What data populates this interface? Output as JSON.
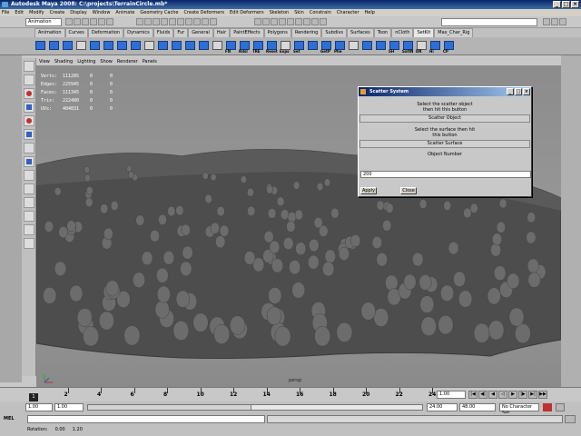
{
  "window": {
    "title": "Autodesk Maya 2008: C:\\projects\\TerrainCircle.mb*",
    "controls": [
      "_",
      "□",
      "×"
    ]
  },
  "menubar": [
    "File",
    "Edit",
    "Modify",
    "Create",
    "Display",
    "Window",
    "Animate",
    "Geometry Cache",
    "Create Deformers",
    "Edit Deformers",
    "Skeleton",
    "Skin",
    "Constrain",
    "Character",
    "Help"
  ],
  "status_line": {
    "mode": "Animation"
  },
  "shelf": {
    "tabs": [
      "Animation",
      "Curves",
      "Deformation",
      "Dynamics",
      "Fluids",
      "Fur",
      "General",
      "Hair",
      "PaintEffects",
      "Polygons",
      "Rendering",
      "Subdivs",
      "Surfaces",
      "Toon",
      "nCloth",
      "SetKit",
      "Max_Char_Rig"
    ],
    "active_tab": "SetKit",
    "buttons": [
      "",
      "",
      "",
      "",
      "",
      "",
      "",
      "",
      "",
      "",
      "",
      "",
      "",
      "",
      "FN",
      "Rdsl",
      "TRE",
      "Reset",
      "Exps",
      "Set",
      "",
      "GetP",
      "Phe",
      "",
      "",
      "",
      "SH",
      "SatIN",
      "DR",
      "Hi",
      "CP"
    ]
  },
  "viewport": {
    "menus": [
      "View",
      "Shading",
      "Lighting",
      "Show",
      "Renderer",
      "Panels"
    ],
    "hud": [
      {
        "label": "Verts:",
        "v1": "111285",
        "v2": "0",
        "v3": "0"
      },
      {
        "label": "Edges:",
        "v1": "225945",
        "v2": "0",
        "v3": "0"
      },
      {
        "label": "Faces:",
        "v1": "111345",
        "v2": "0",
        "v3": "0"
      },
      {
        "label": "Tris:",
        "v1": "222480",
        "v2": "0",
        "v3": "0"
      },
      {
        "label": "UVs:",
        "v1": "404831",
        "v2": "0",
        "v3": "0"
      }
    ],
    "camera": "persp"
  },
  "scatter_dialog": {
    "title": "Scatter System",
    "text1": "Select the scatter object then hit this button",
    "btn1": "Scatter Object",
    "text2": "Select the surface then hit this button",
    "btn2": "Scatter Surface",
    "obj_label": "Object Number",
    "obj_value": "200",
    "apply": "Apply",
    "close": "Close"
  },
  "timeline": {
    "ticks": [
      "2",
      "4",
      "6",
      "8",
      "10",
      "12",
      "14",
      "16",
      "18",
      "20",
      "22",
      "24"
    ],
    "current_frame": "1",
    "current_field": "1.00"
  },
  "range": {
    "start": "1.00",
    "start2": "1.00",
    "end": "24.00",
    "end2": "48.00",
    "character_set": "No Character Set"
  },
  "command_line": {
    "label": "MEL"
  },
  "help_line": {
    "rotation": "Rotation:",
    "v1": "0.00",
    "v2": "1.20"
  },
  "colors": {
    "title_bg": "#0a246a",
    "shelf_icon": "#2d6fd6",
    "mesh": "#4a4a4a",
    "heads": "#6a6a6a"
  }
}
